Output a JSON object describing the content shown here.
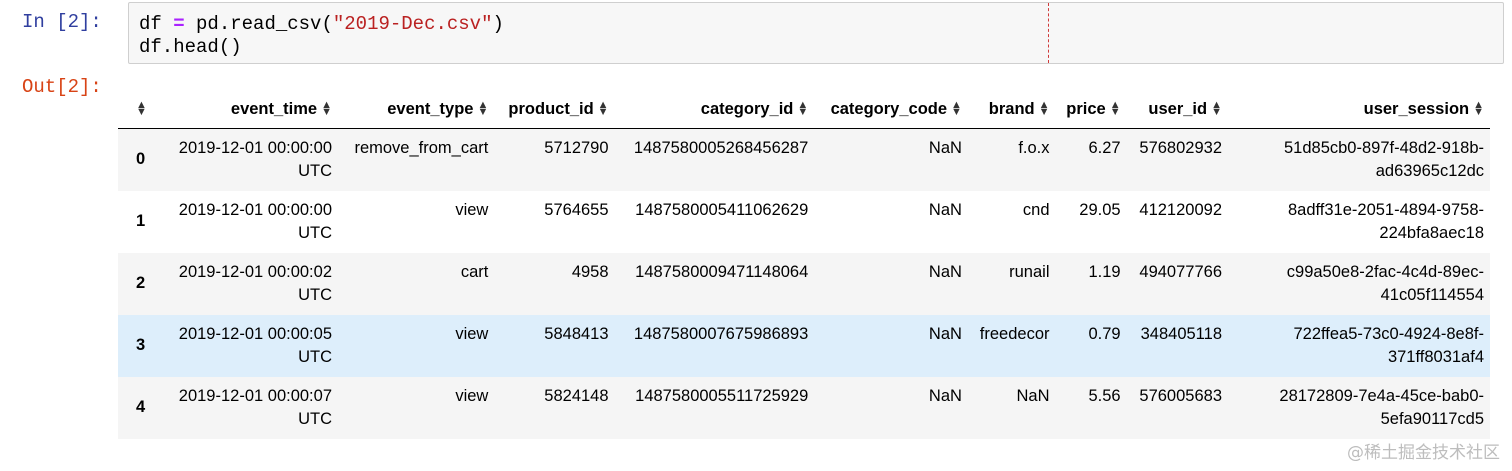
{
  "cell": {
    "in_prompt": "In [2]:",
    "out_prompt": "Out[2]:",
    "code": {
      "l1_a": "df ",
      "l1_op": "=",
      "l1_b": " pd.read_csv(",
      "l1_str": "\"2019-Dec.csv\"",
      "l1_c": ")",
      "l2": "df.head()"
    }
  },
  "table": {
    "columns": [
      "event_time",
      "event_type",
      "product_id",
      "category_id",
      "category_code",
      "brand",
      "price",
      "user_id",
      "user_session"
    ],
    "rows": [
      {
        "index": "0",
        "event_time": "2019-12-01 00:00:00 UTC",
        "event_type": "remove_from_cart",
        "product_id": "5712790",
        "category_id": "1487580005268456287",
        "category_code": "NaN",
        "brand": "f.o.x",
        "price": "6.27",
        "user_id": "576802932",
        "user_session": "51d85cb0-897f-48d2-918b-ad63965c12dc"
      },
      {
        "index": "1",
        "event_time": "2019-12-01 00:00:00 UTC",
        "event_type": "view",
        "product_id": "5764655",
        "category_id": "1487580005411062629",
        "category_code": "NaN",
        "brand": "cnd",
        "price": "29.05",
        "user_id": "412120092",
        "user_session": "8adff31e-2051-4894-9758-224bfa8aec18"
      },
      {
        "index": "2",
        "event_time": "2019-12-01 00:00:02 UTC",
        "event_type": "cart",
        "product_id": "4958",
        "category_id": "1487580009471148064",
        "category_code": "NaN",
        "brand": "runail",
        "price": "1.19",
        "user_id": "494077766",
        "user_session": "c99a50e8-2fac-4c4d-89ec-41c05f114554"
      },
      {
        "index": "3",
        "event_time": "2019-12-01 00:00:05 UTC",
        "event_type": "view",
        "product_id": "5848413",
        "category_id": "1487580007675986893",
        "category_code": "NaN",
        "brand": "freedecor",
        "price": "0.79",
        "user_id": "348405118",
        "user_session": "722ffea5-73c0-4924-8e8f-371ff8031af4"
      },
      {
        "index": "4",
        "event_time": "2019-12-01 00:00:07 UTC",
        "event_type": "view",
        "product_id": "5824148",
        "category_id": "1487580005511725929",
        "category_code": "NaN",
        "brand": "NaN",
        "price": "5.56",
        "user_id": "576005683",
        "user_session": "28172809-7e4a-45ce-bab0-5efa90117cd5"
      }
    ]
  },
  "watermark": "@稀土掘金技术社区",
  "icons": {
    "sort": "sort-icon"
  },
  "colors": {
    "in_prompt": "#303f9f",
    "out_prompt": "#d84315",
    "row_hover": "#ddeefb",
    "row_odd": "#f5f5f5"
  }
}
